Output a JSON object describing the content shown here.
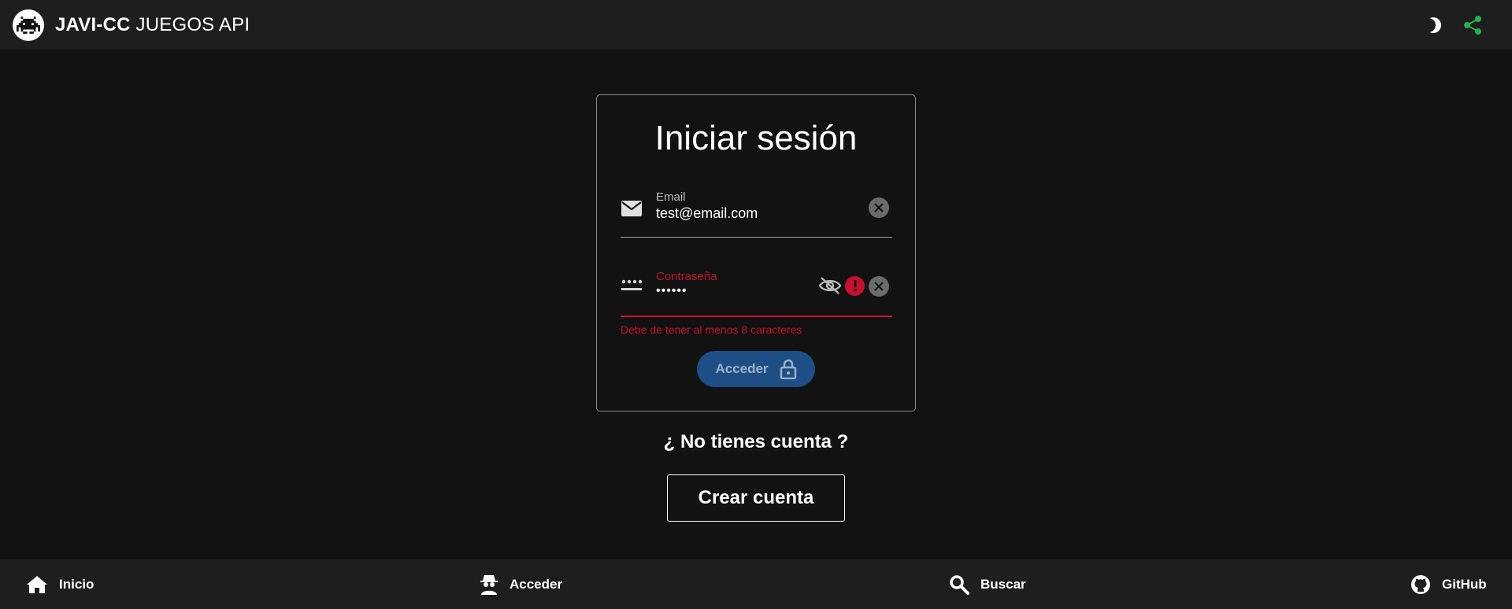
{
  "header": {
    "brand_bold": "JAVI-CC",
    "brand_light": " JUEGOS API",
    "logo_icon": "space-invader-icon",
    "theme_icon": "moon-icon",
    "share_icon": "share-icon",
    "share_color": "#22b14c"
  },
  "login": {
    "title": "Iniciar sesión",
    "email": {
      "label": "Email",
      "value": "test@email.com",
      "icon": "envelope-icon"
    },
    "password": {
      "label": "Contraseña",
      "value": "••••••",
      "icon": "password-dots-icon",
      "error": "Debe de tener al menos 8 caracteres"
    },
    "submit_label": "Acceder",
    "submit_icon": "lock-icon"
  },
  "signup": {
    "prompt": "¿ No tienes cuenta ?",
    "button_label": "Crear cuenta"
  },
  "nav": {
    "items": [
      {
        "label": "Inicio",
        "icon": "home-icon"
      },
      {
        "label": "Acceder",
        "icon": "spy-icon"
      },
      {
        "label": "Buscar",
        "icon": "search-icon"
      },
      {
        "label": "GitHub",
        "icon": "github-icon"
      }
    ]
  },
  "colors": {
    "background": "#121212",
    "bar": "#1e1e1e",
    "error": "#c8102e",
    "primary_button": "#1d4f86"
  }
}
